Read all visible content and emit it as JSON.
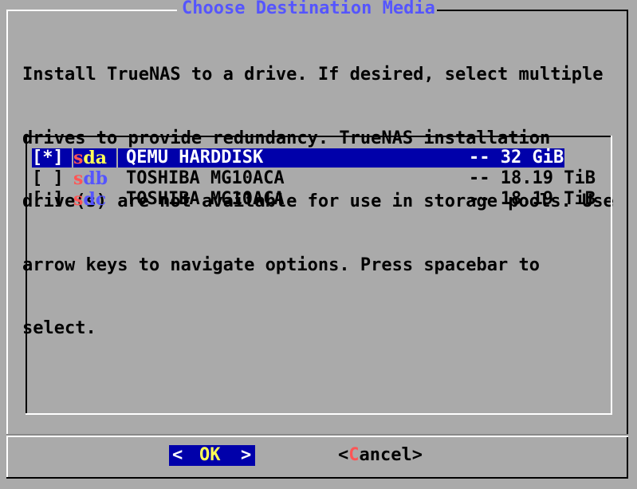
{
  "dialog": {
    "title": "Choose Destination Media",
    "message_lines": [
      "Install TrueNAS to a drive. If desired, select multiple",
      "drives to provide redundancy. TrueNAS installation",
      "drive(s) are not available for use in storage pools. Use",
      "arrow keys to navigate options. Press spacebar to",
      "select."
    ]
  },
  "drives": [
    {
      "check": "[*]",
      "tag_first": "s",
      "tag_rest": "da",
      "description": "QEMU HARDDISK",
      "size": "-- 32 GiB",
      "selected": true
    },
    {
      "check": "[ ]",
      "tag_first": "s",
      "tag_rest": "db",
      "description": "TOSHIBA MG10ACA",
      "size": "-- 18.19 TiB",
      "selected": false
    },
    {
      "check": "[ ]",
      "tag_first": "s",
      "tag_rest": "dc",
      "description": "TOSHIBA MG10ACA",
      "size": "-- 18.19 TiB",
      "selected": false
    }
  ],
  "buttons": {
    "ok": {
      "left_arrow": "<",
      "label": "OK",
      "right_arrow": ">"
    },
    "cancel": {
      "open": "<",
      "first": "C",
      "rest": "ancel",
      "close": ">"
    }
  },
  "colors": {
    "background": "#aaaaaa",
    "title": "#5555ff",
    "selection": "#0000aa",
    "hotkey": "#ff5555"
  }
}
